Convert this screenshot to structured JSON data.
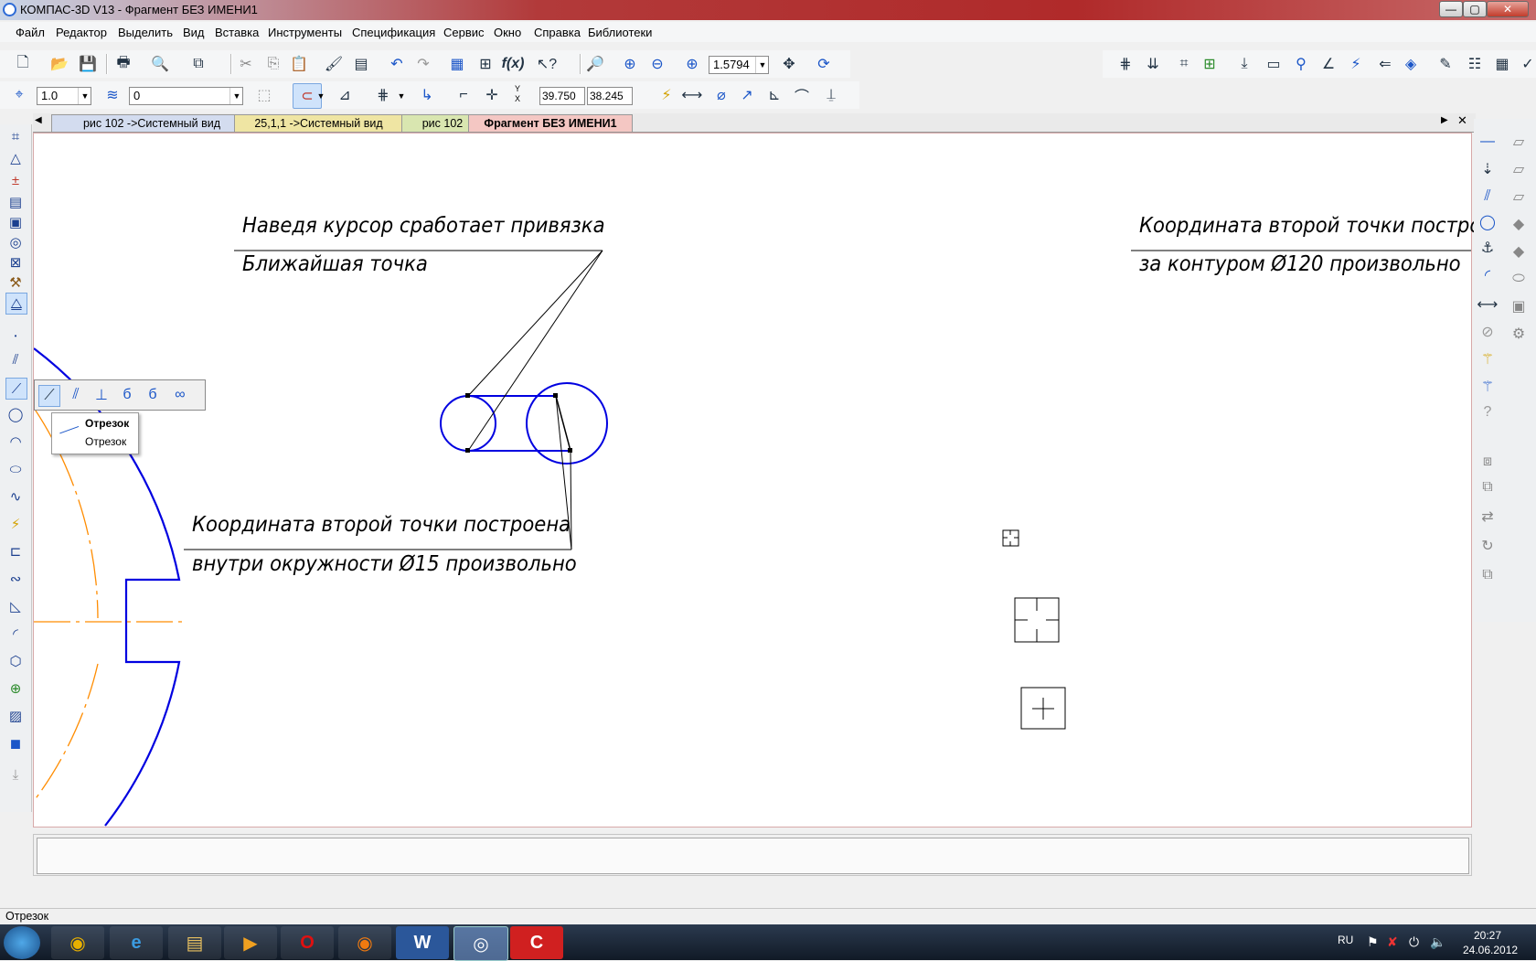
{
  "window": {
    "title": "КОМПАС-3D V13 - Фрагмент БЕЗ ИМЕНИ1"
  },
  "menu": [
    "Файл",
    "Редактор",
    "Выделить",
    "Вид",
    "Вставка",
    "Инструменты",
    "Спецификация",
    "Сервис",
    "Окно",
    "Справка",
    "Библиотеки"
  ],
  "toolbar": {
    "zoom_value": "1.5794",
    "line_scale": "1.0",
    "layer": "0",
    "coord_x": "39.750",
    "coord_y": "38.245",
    "coord_axes": "Y X"
  },
  "tabs": [
    "рис 102 ->Системный вид",
    "25,1,1 ->Системный вид",
    "рис 102",
    "Фрагмент БЕЗ ИМЕНИ1"
  ],
  "popup": {
    "tooltip_title": "Отрезок",
    "tooltip_sub": "Отрезок"
  },
  "drawing": {
    "note1_line1": "Наведя курсор сработает привязка",
    "note1_line2": "Ближайшая точка",
    "note2_line1": "Координата второй точки построена",
    "note2_line2": "внутри окружности Ø15 произвольно",
    "note3_line1": "Координата второй точки постро",
    "note3_line2": "за контуром Ø120 произвольно"
  },
  "status": {
    "text": "Отрезок"
  },
  "tray": {
    "lang": "RU",
    "time": "20:27",
    "date": "24.06.2012"
  },
  "colors": {
    "titlebar": "#b02a2a",
    "drawing_line": "#0000e0",
    "axis_line": "#ff8c00",
    "active_tab": "#f4c7c3"
  }
}
